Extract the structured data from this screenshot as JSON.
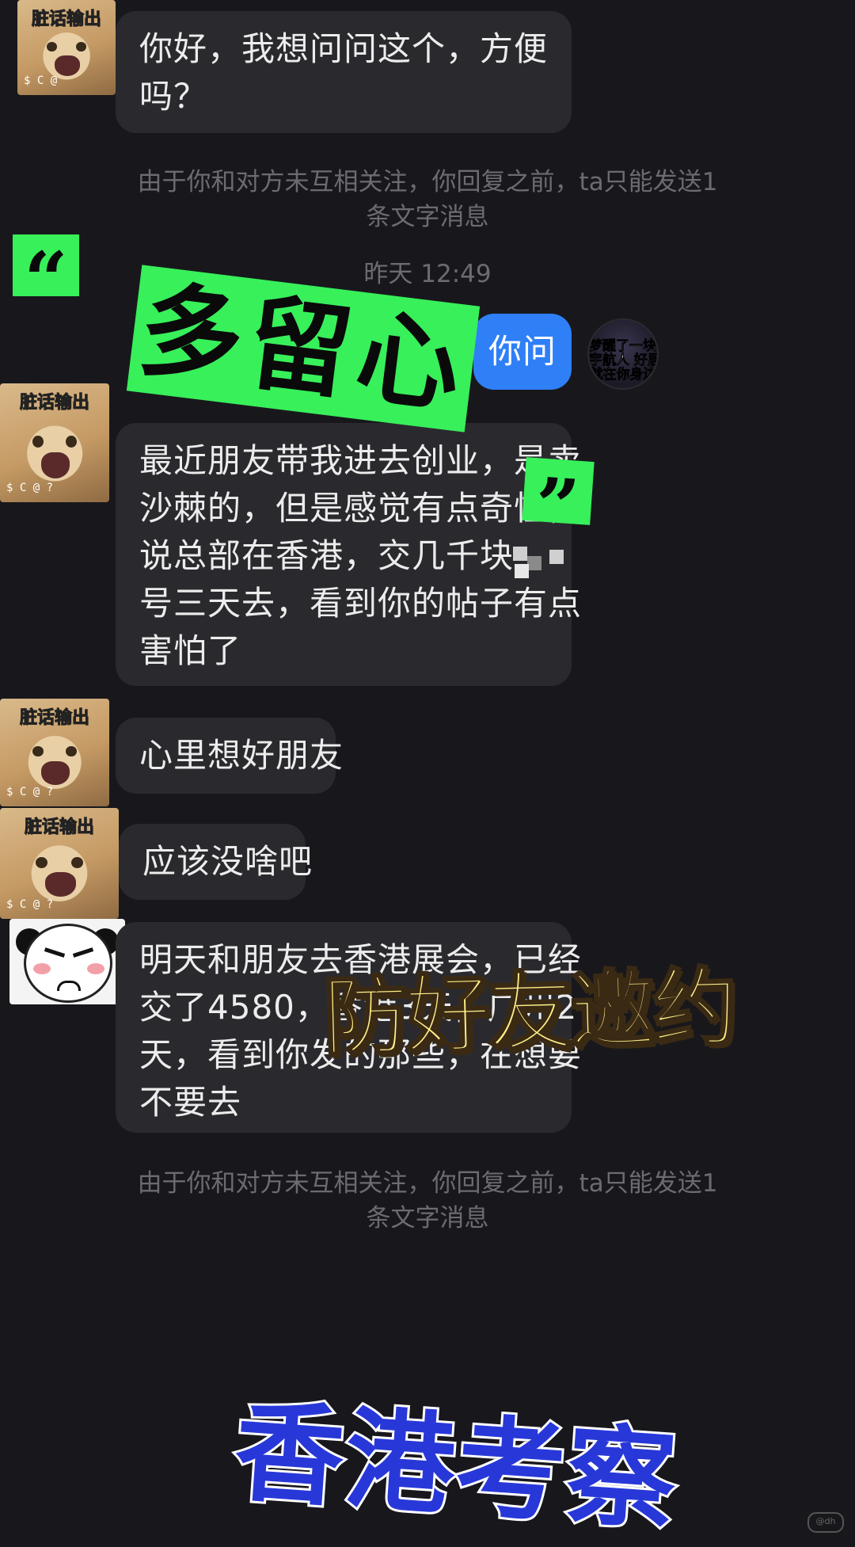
{
  "avatar_caption": "脏话输出",
  "self_avatar_lines": [
    "梦醒了一块跑",
    "宇航人 好居",
    "就在你身边"
  ],
  "messages": [
    {
      "id": "m1",
      "lines": [
        "你好，我想问问这个，方便",
        "吗？"
      ]
    },
    {
      "id": "reply",
      "text": "你问"
    },
    {
      "id": "m2",
      "lines": [
        "最近朋友带我进去创业，是卖",
        "沙棘的，但是感觉有点奇怪，",
        "说总部在香港，交几千块",
        "号三天去，看到你的帖子有点",
        "害怕了"
      ]
    },
    {
      "id": "m3",
      "lines": [
        "心里想好朋友"
      ]
    },
    {
      "id": "m4",
      "lines": [
        "应该没啥吧"
      ]
    },
    {
      "id": "m5",
      "lines": [
        "明天和朋友去香港展会，已经",
        "交了4580，香港3天，广州2",
        "天，看到你发的那些，在想要",
        "不要去"
      ]
    }
  ],
  "system_notice": {
    "line1": "由于你和对方未互相关注，你回复之前，ta只能发送1",
    "line2": "条文字消息"
  },
  "system_notice_bottom": {
    "line1": "由于你和对方未互相关注，你回复之前，ta只能发送1",
    "line2": "条文字消息"
  },
  "timestamp": "昨天 12:49",
  "overlays": {
    "open_quote": "“",
    "close_quote": "”",
    "green_title": "多留心",
    "yellow_title": "防好友邀约",
    "blue_title": "香港考察"
  },
  "watermark": "@dh",
  "colors": {
    "background": "#18181c",
    "bubble_other": "#2a2a2e",
    "bubble_mine": "#2f7ff7",
    "sticker_green": "#37f05a",
    "title_yellow": "#fff08a",
    "title_blue": "#2838d8"
  }
}
